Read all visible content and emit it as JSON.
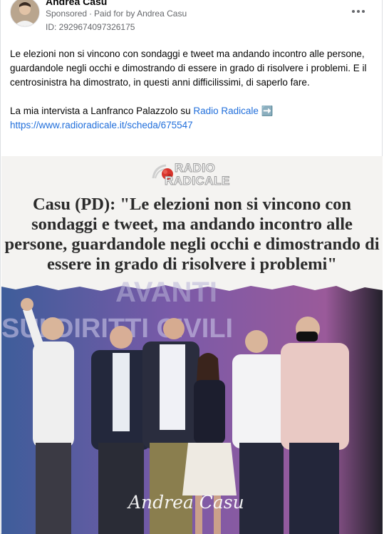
{
  "post": {
    "author": "Andrea Casu",
    "sponsored": "Sponsored",
    "paid_for": "Paid for by Andrea Casu",
    "ad_id": "ID: 2929674097326175",
    "more_icon": "more-horizontal-icon",
    "paragraph1": "Le elezioni non si vincono con sondaggi e tweet ma andando incontro alle persone, guardandole negli occhi e dimostrando di essere in grado di risolvere i problemi. E il centrosinistra ha dimostrato, in questi anni difficilissimi, di saperlo fare.",
    "paragraph2_prefix": "La mia intervista a Lanfranco Palazzolo su ",
    "paragraph2_link": "Radio Radicale",
    "paragraph2_arrow": "➡️",
    "url": "https://www.radioradicale.it/scheda/675547"
  },
  "creative": {
    "logo_line1": "RADIO",
    "logo_line2": "RADICALE",
    "headline": "Casu (PD): \"Le elezioni non si vincono con sondaggi e tweet, ma andando incontro alle persone, guardandole negli occhi e dimostrando di essere in grado di risolvere i problemi\"",
    "banner_text": "AVANTI",
    "banner_text2": "SUI DIRITTI CIVILI",
    "signature": "Andrea Casu"
  },
  "colors": {
    "link": "#216fdb",
    "stage_purple": "#7a5aa8"
  }
}
